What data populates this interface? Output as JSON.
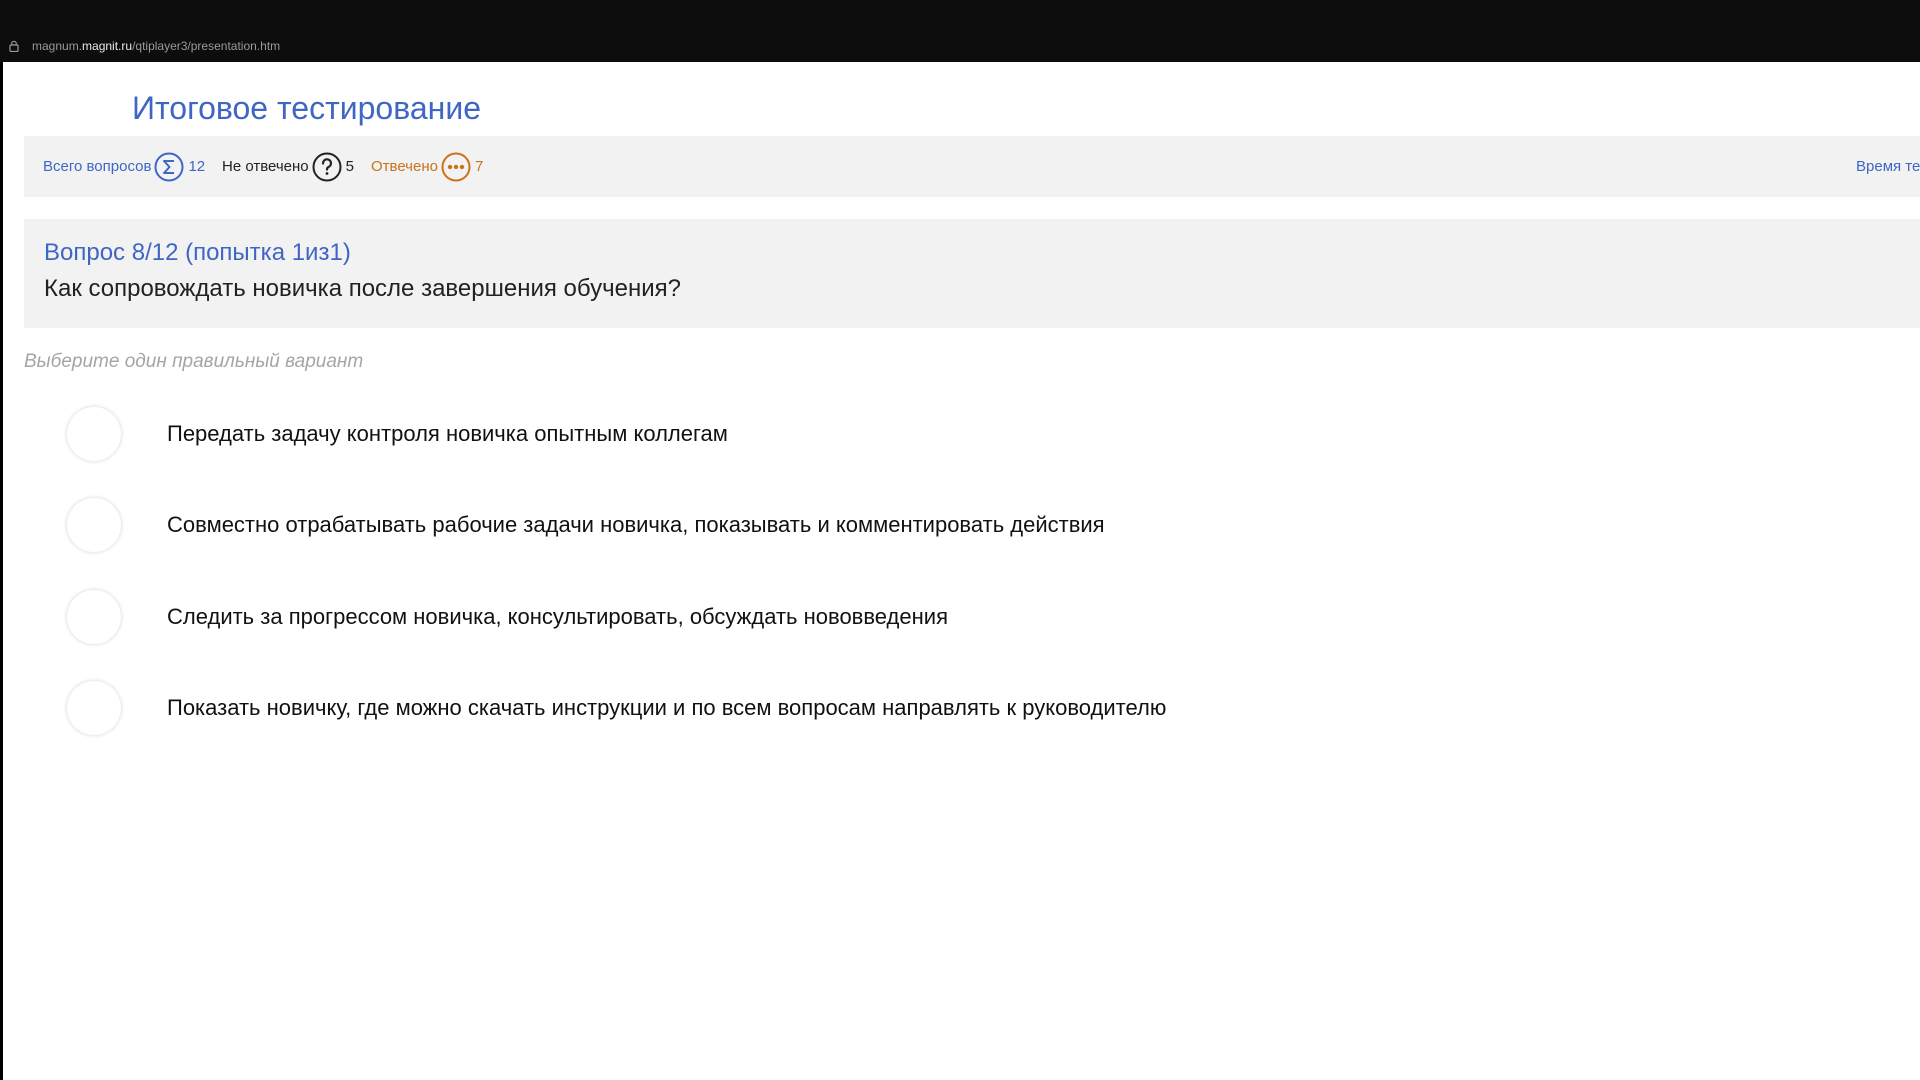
{
  "browser": {
    "url_prefix": "magnum.",
    "url_host": "magnit.ru",
    "url_path": "/qtiplayer3/presentation.htm"
  },
  "page": {
    "title": "Итоговое тестирование"
  },
  "stats": {
    "total_label": "Всего вопросов",
    "total_value": "12",
    "unanswered_label": "Не отвечено",
    "unanswered_value": "5",
    "answered_label": "Отвечено",
    "answered_value": "7",
    "time_label": "Время те"
  },
  "question": {
    "number": "Вопрос 8/12  (попытка 1из1)",
    "text": "Как сопровождать новичка после завершения обучения?",
    "hint": "Выберите один правильный вариант",
    "options": [
      "Передать задачу контроля новичка опытным коллегам",
      "Совместно отрабатывать рабочие задачи новичка, показывать и комментировать действия",
      "Следить за прогрессом новичка, консультировать, обсуждать нововведения",
      "Показать новичку, где можно скачать инструкции и по всем вопросам направлять к руководителю"
    ]
  },
  "colors": {
    "accent_blue": "#3f66c4",
    "answered_orange": "#c9721a",
    "panel_gray": "#f2f2f2",
    "hint_gray": "#a5a5a5"
  },
  "icons": {
    "lock": "lock-icon",
    "total": "sigma-icon",
    "unanswered": "question-mark-icon",
    "answered": "ellipsis-icon"
  }
}
